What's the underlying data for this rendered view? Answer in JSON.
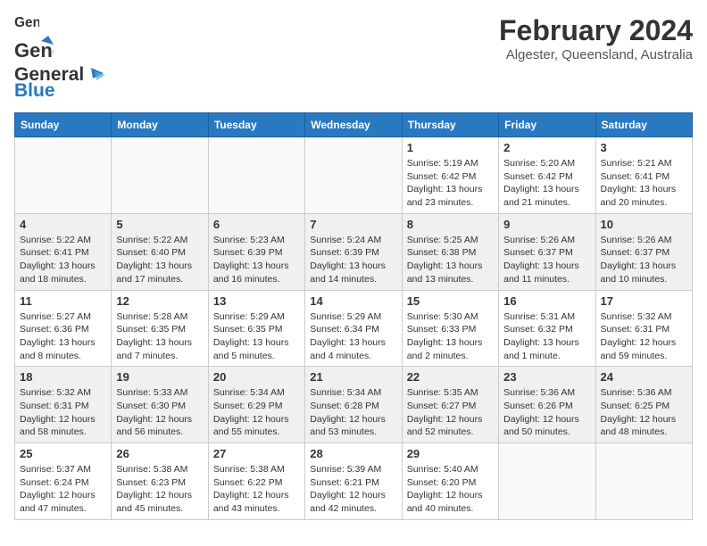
{
  "header": {
    "logo_general": "General",
    "logo_blue": "Blue",
    "month_year": "February 2024",
    "location": "Algester, Queensland, Australia"
  },
  "weekdays": [
    "Sunday",
    "Monday",
    "Tuesday",
    "Wednesday",
    "Thursday",
    "Friday",
    "Saturday"
  ],
  "weeks": [
    {
      "shaded": false,
      "days": [
        {
          "num": "",
          "info": ""
        },
        {
          "num": "",
          "info": ""
        },
        {
          "num": "",
          "info": ""
        },
        {
          "num": "",
          "info": ""
        },
        {
          "num": "1",
          "info": "Sunrise: 5:19 AM\nSunset: 6:42 PM\nDaylight: 13 hours\nand 23 minutes."
        },
        {
          "num": "2",
          "info": "Sunrise: 5:20 AM\nSunset: 6:42 PM\nDaylight: 13 hours\nand 21 minutes."
        },
        {
          "num": "3",
          "info": "Sunrise: 5:21 AM\nSunset: 6:41 PM\nDaylight: 13 hours\nand 20 minutes."
        }
      ]
    },
    {
      "shaded": true,
      "days": [
        {
          "num": "4",
          "info": "Sunrise: 5:22 AM\nSunset: 6:41 PM\nDaylight: 13 hours\nand 18 minutes."
        },
        {
          "num": "5",
          "info": "Sunrise: 5:22 AM\nSunset: 6:40 PM\nDaylight: 13 hours\nand 17 minutes."
        },
        {
          "num": "6",
          "info": "Sunrise: 5:23 AM\nSunset: 6:39 PM\nDaylight: 13 hours\nand 16 minutes."
        },
        {
          "num": "7",
          "info": "Sunrise: 5:24 AM\nSunset: 6:39 PM\nDaylight: 13 hours\nand 14 minutes."
        },
        {
          "num": "8",
          "info": "Sunrise: 5:25 AM\nSunset: 6:38 PM\nDaylight: 13 hours\nand 13 minutes."
        },
        {
          "num": "9",
          "info": "Sunrise: 5:26 AM\nSunset: 6:37 PM\nDaylight: 13 hours\nand 11 minutes."
        },
        {
          "num": "10",
          "info": "Sunrise: 5:26 AM\nSunset: 6:37 PM\nDaylight: 13 hours\nand 10 minutes."
        }
      ]
    },
    {
      "shaded": false,
      "days": [
        {
          "num": "11",
          "info": "Sunrise: 5:27 AM\nSunset: 6:36 PM\nDaylight: 13 hours\nand 8 minutes."
        },
        {
          "num": "12",
          "info": "Sunrise: 5:28 AM\nSunset: 6:35 PM\nDaylight: 13 hours\nand 7 minutes."
        },
        {
          "num": "13",
          "info": "Sunrise: 5:29 AM\nSunset: 6:35 PM\nDaylight: 13 hours\nand 5 minutes."
        },
        {
          "num": "14",
          "info": "Sunrise: 5:29 AM\nSunset: 6:34 PM\nDaylight: 13 hours\nand 4 minutes."
        },
        {
          "num": "15",
          "info": "Sunrise: 5:30 AM\nSunset: 6:33 PM\nDaylight: 13 hours\nand 2 minutes."
        },
        {
          "num": "16",
          "info": "Sunrise: 5:31 AM\nSunset: 6:32 PM\nDaylight: 13 hours\nand 1 minute."
        },
        {
          "num": "17",
          "info": "Sunrise: 5:32 AM\nSunset: 6:31 PM\nDaylight: 12 hours\nand 59 minutes."
        }
      ]
    },
    {
      "shaded": true,
      "days": [
        {
          "num": "18",
          "info": "Sunrise: 5:32 AM\nSunset: 6:31 PM\nDaylight: 12 hours\nand 58 minutes."
        },
        {
          "num": "19",
          "info": "Sunrise: 5:33 AM\nSunset: 6:30 PM\nDaylight: 12 hours\nand 56 minutes."
        },
        {
          "num": "20",
          "info": "Sunrise: 5:34 AM\nSunset: 6:29 PM\nDaylight: 12 hours\nand 55 minutes."
        },
        {
          "num": "21",
          "info": "Sunrise: 5:34 AM\nSunset: 6:28 PM\nDaylight: 12 hours\nand 53 minutes."
        },
        {
          "num": "22",
          "info": "Sunrise: 5:35 AM\nSunset: 6:27 PM\nDaylight: 12 hours\nand 52 minutes."
        },
        {
          "num": "23",
          "info": "Sunrise: 5:36 AM\nSunset: 6:26 PM\nDaylight: 12 hours\nand 50 minutes."
        },
        {
          "num": "24",
          "info": "Sunrise: 5:36 AM\nSunset: 6:25 PM\nDaylight: 12 hours\nand 48 minutes."
        }
      ]
    },
    {
      "shaded": false,
      "days": [
        {
          "num": "25",
          "info": "Sunrise: 5:37 AM\nSunset: 6:24 PM\nDaylight: 12 hours\nand 47 minutes."
        },
        {
          "num": "26",
          "info": "Sunrise: 5:38 AM\nSunset: 6:23 PM\nDaylight: 12 hours\nand 45 minutes."
        },
        {
          "num": "27",
          "info": "Sunrise: 5:38 AM\nSunset: 6:22 PM\nDaylight: 12 hours\nand 43 minutes."
        },
        {
          "num": "28",
          "info": "Sunrise: 5:39 AM\nSunset: 6:21 PM\nDaylight: 12 hours\nand 42 minutes."
        },
        {
          "num": "29",
          "info": "Sunrise: 5:40 AM\nSunset: 6:20 PM\nDaylight: 12 hours\nand 40 minutes."
        },
        {
          "num": "",
          "info": ""
        },
        {
          "num": "",
          "info": ""
        }
      ]
    }
  ]
}
